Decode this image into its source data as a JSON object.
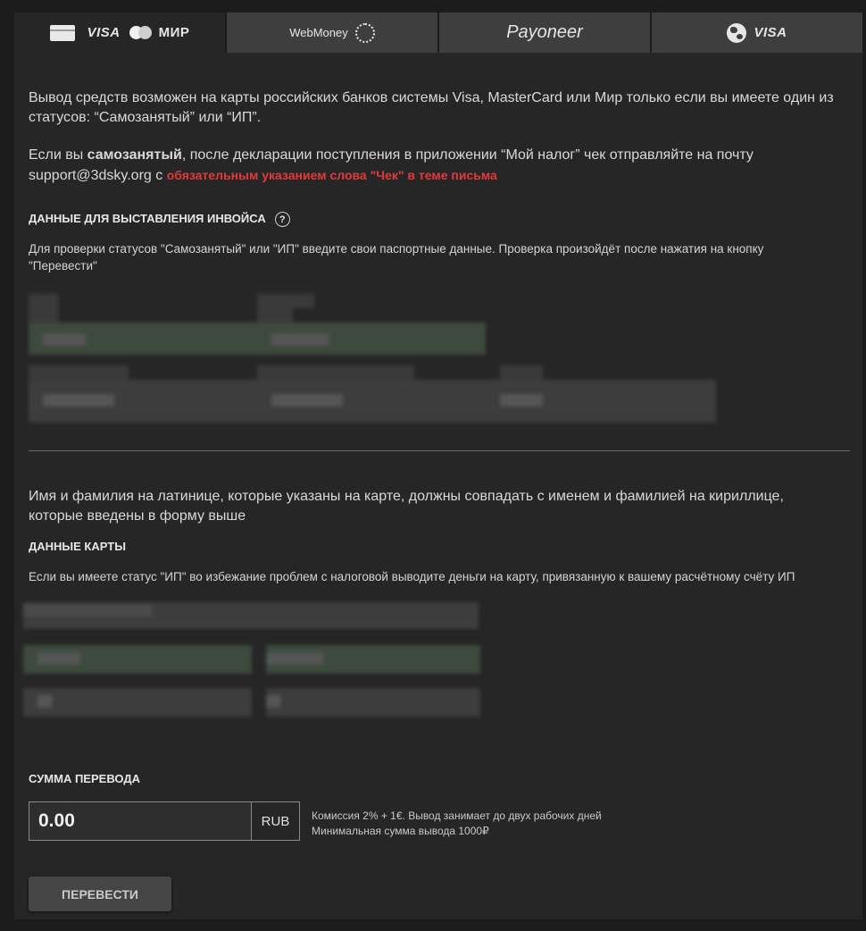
{
  "tabs": {
    "visa_mir": {
      "visa_label": "VISA",
      "mir_label": "МИР"
    },
    "webmoney": {
      "label": "WebMoney"
    },
    "payoneer": {
      "label": "Payoneer"
    },
    "visa_intl": {
      "label": "VISA"
    }
  },
  "intro": {
    "line1": "Вывод средств возможен на карты российских банков системы Visa, MasterCard или Мир только если вы имеете один из",
    "line2": "статусов: “Самозанятый” или “ИП”.",
    "self_p1": "Если вы ",
    "self_bold": "самозанятый",
    "self_p2": ", после декларации поступления в приложении “Мой налог” чек отправляйте на почту",
    "email": "support@3dsky.org с ",
    "warning": "обязательным указанием слова \"Чек\" в теме письма"
  },
  "invoice": {
    "heading": "ДАННЫЕ ДЛЯ ВЫСТАВЛЕНИЯ ИНВОЙСА",
    "help_icon": "?",
    "note_line1": "Для проверки статусов \"Самозанятый\" или \"ИП\" введите свои паспортные данные. Проверка произойдёт после нажатия на кнопку",
    "note_line2": "\"Перевести\""
  },
  "card": {
    "note_line1": "Имя и фамилия на латинице, которые указаны на карте, должны совпадать с именем и фамилией на кириллице,",
    "note_line2": "которые введены в форму выше",
    "heading": "ДАННЫЕ КАРТЫ",
    "ip_note": "Если вы имеете статус \"ИП\" во избежание проблем с налоговой выводите деньги на карту, привязанную к вашему расчётному счёту ИП"
  },
  "transfer": {
    "heading": "СУММА ПЕРЕВОДА",
    "amount_value": "0.00",
    "currency": "RUB",
    "fee_line1": "Комиссия 2% + 1€. Вывод занимает до двух рабочих дней",
    "fee_line2": "Минимальная сумма вывода 1000₽",
    "submit_label": "ПЕРЕВЕСТИ"
  }
}
